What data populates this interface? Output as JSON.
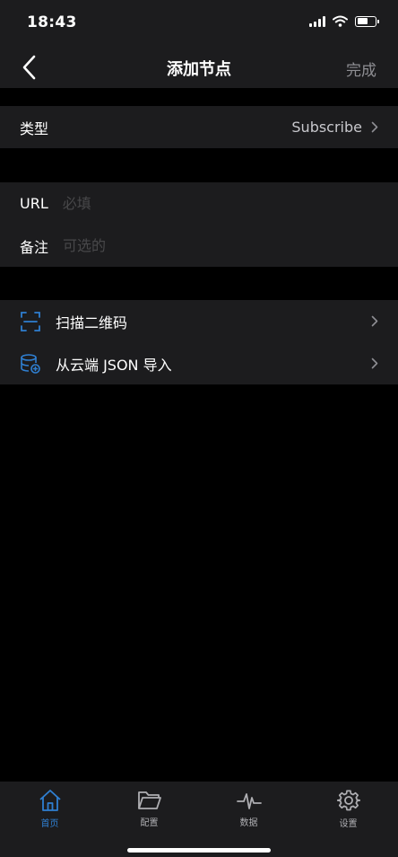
{
  "status_bar": {
    "time": "18:43"
  },
  "nav": {
    "title": "添加节点",
    "done_label": "完成"
  },
  "type_row": {
    "label": "类型",
    "value": "Subscribe"
  },
  "url_field": {
    "label": "URL",
    "placeholder": "必填",
    "value": ""
  },
  "remark_field": {
    "label": "备注",
    "placeholder": "可选的",
    "value": ""
  },
  "actions": {
    "scan_label": "扫描二维码",
    "import_label": "从云端 JSON 导入"
  },
  "tabbar": {
    "items": [
      {
        "label": "首页",
        "icon": "home-icon",
        "active": true
      },
      {
        "label": "配置",
        "icon": "folder-icon",
        "active": false
      },
      {
        "label": "数据",
        "icon": "pulse-icon",
        "active": false
      },
      {
        "label": "设置",
        "icon": "gear-icon",
        "active": false
      }
    ]
  },
  "colors": {
    "background": "#000000",
    "surface": "#1c1c1e",
    "accent": "#2f7fd1",
    "secondary_text": "#8e8e93",
    "placeholder": "#48484a"
  }
}
